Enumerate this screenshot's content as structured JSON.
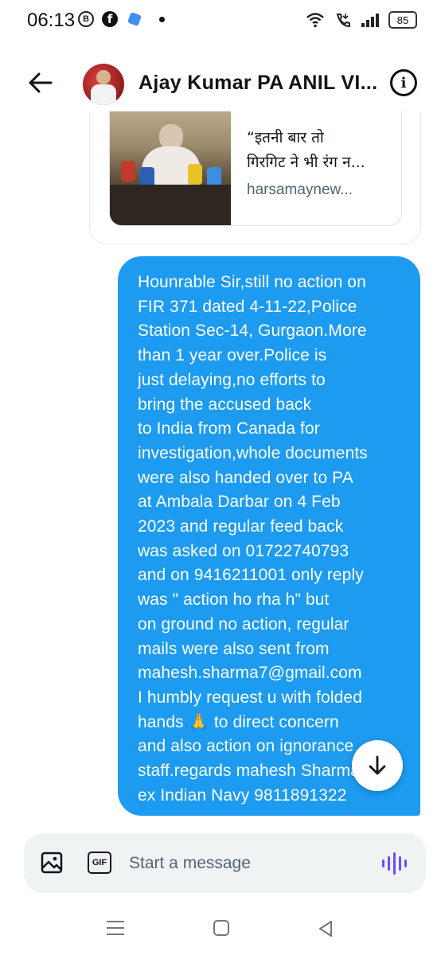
{
  "status_bar": {
    "time": "06:13",
    "battery": "85",
    "left_icons": [
      "b-badge-icon",
      "facebook-icon",
      "app-icon",
      "dot-icon"
    ],
    "right_icons": [
      "wifi-icon",
      "volte-call-icon",
      "signal-icon",
      "battery-icon"
    ]
  },
  "header": {
    "contact_name": "Ajay Kumar PA ANIL VI...",
    "back_icon": "arrow-left-icon",
    "info_icon": "info-icon",
    "info_glyph": "i"
  },
  "shared_card": {
    "title_line1": "“इतनी बार तो",
    "title_line2": "गिरगिट ने भी रंग न...",
    "domain": "harsamaynew..."
  },
  "message": {
    "text": "Hounrable Sir,still no action on\nFIR 371 dated 4-11-22,Police\nStation Sec-14, Gurgaon.More\nthan 1 year over.Police is\njust delaying,no efforts to\nbring the accused back\nto India from Canada for\ninvestigation,whole documents\nwere also handed over to PA\nat Ambala Darbar on 4 Feb\n2023 and regular feed back\nwas asked on 01722740793\nand on 9416211001 only reply\nwas \" action ho rha h\" but\non ground no action, regular\nmails were also sent from\nmahesh.sharma7@gmail.com\nI humbly request u with folded\nhands 🙏 to direct concern\nand also action on ignorance\nstaff.regards mahesh Sharma\nex Indian Navy 9811891322"
  },
  "composer": {
    "placeholder": "Start a message",
    "gif_label": "GIF"
  },
  "colors": {
    "accent": "#1d9bf0",
    "composer_bg": "#eff3f4",
    "voice": "#6f4cf5"
  }
}
